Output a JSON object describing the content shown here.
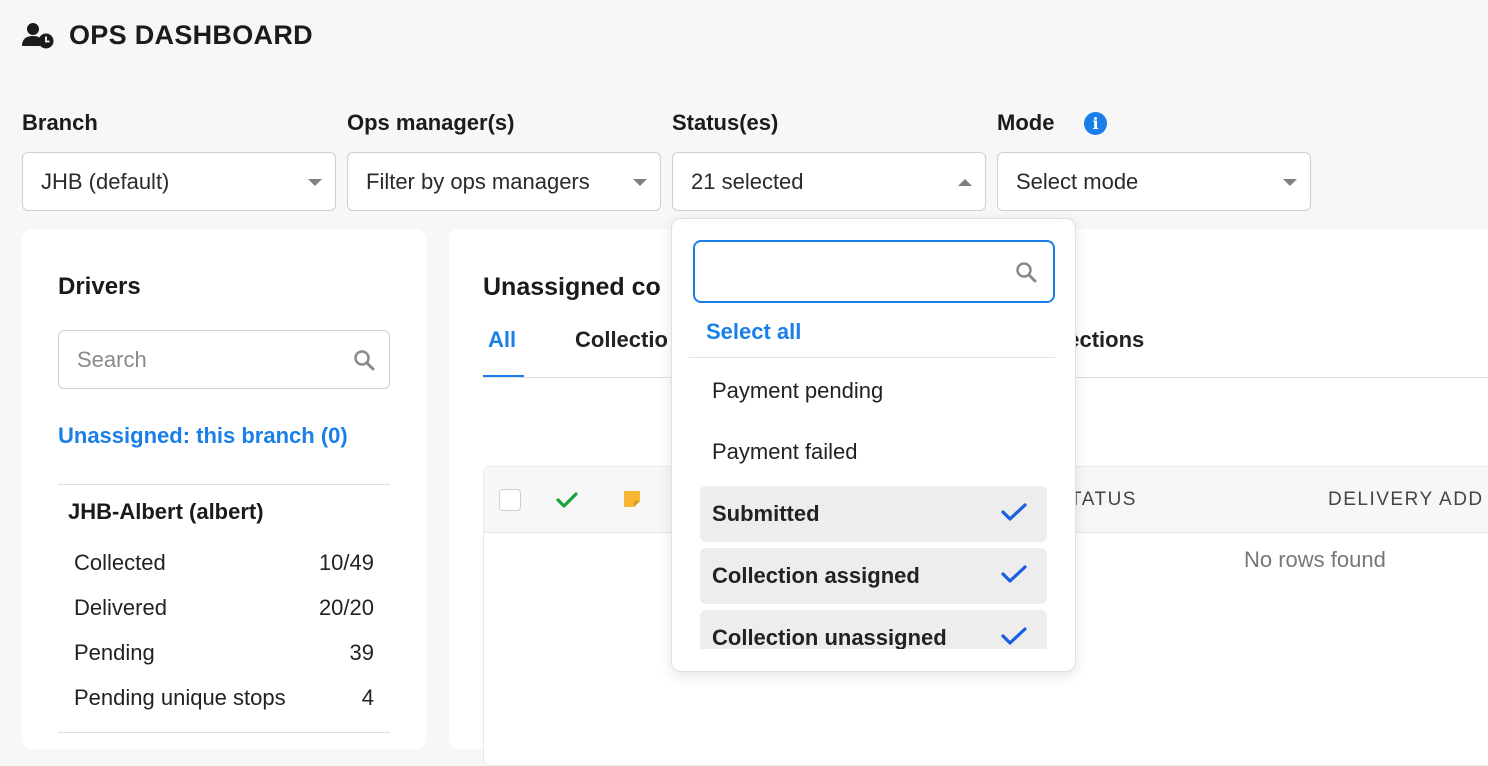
{
  "header": {
    "title": "OPS DASHBOARD",
    "icon": "user-clock-icon"
  },
  "filters": {
    "branch": {
      "label": "Branch",
      "value": "JHB (default)"
    },
    "ops_managers": {
      "label": "Ops manager(s)",
      "placeholder": "Filter by ops managers"
    },
    "statuses": {
      "label": "Status(es)",
      "value": "21 selected"
    },
    "mode": {
      "label": "Mode",
      "placeholder": "Select mode",
      "info_icon": "info-icon"
    }
  },
  "drivers": {
    "title": "Drivers",
    "search_placeholder": "Search",
    "unassigned_link": "Unassigned: this branch (0)",
    "driver": {
      "name": "JHB-Albert (albert)",
      "stats": [
        {
          "label": "Collected",
          "value": "10/49"
        },
        {
          "label": "Delivered",
          "value": "20/20"
        },
        {
          "label": "Pending",
          "value": "39"
        },
        {
          "label": "Pending unique stops",
          "value": "4"
        }
      ]
    }
  },
  "main": {
    "title": "Unassigned co",
    "tabs": [
      "All",
      "Collectio",
      "llections"
    ],
    "table": {
      "columns": [
        "TATUS",
        "DELIVERY ADD"
      ],
      "empty_text": "No rows found"
    }
  },
  "status_dropdown": {
    "select_all": "Select all",
    "options": [
      {
        "label": "Payment pending",
        "selected": false
      },
      {
        "label": "Payment failed",
        "selected": false
      },
      {
        "label": "Submitted",
        "selected": true
      },
      {
        "label": "Collection assigned",
        "selected": true
      },
      {
        "label": "Collection unassigned",
        "selected": true
      }
    ]
  },
  "colors": {
    "accent": "#1a7fe8",
    "check_green": "#1aa33a",
    "note_yellow": "#f7b733"
  }
}
